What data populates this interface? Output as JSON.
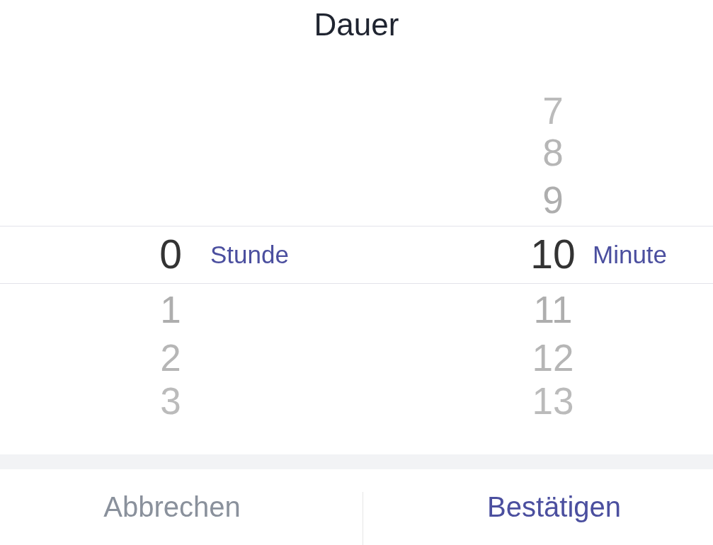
{
  "title": "Dauer",
  "pickers": [
    {
      "items": [
        {
          "value": "0",
          "selected": true
        },
        {
          "value": "1",
          "selected": false
        },
        {
          "value": "2",
          "selected": false
        },
        {
          "value": "3",
          "selected": false
        }
      ],
      "unit": "Stunde"
    },
    {
      "items": [
        {
          "value": "7",
          "selected": false
        },
        {
          "value": "8",
          "selected": false
        },
        {
          "value": "9",
          "selected": false
        },
        {
          "value": "10",
          "selected": true
        },
        {
          "value": "11",
          "selected": false
        },
        {
          "value": "12",
          "selected": false
        },
        {
          "value": "13",
          "selected": false
        }
      ],
      "unit": "Minute"
    }
  ],
  "buttons": [
    {
      "label": "Abbrechen",
      "kind": "cancel"
    },
    {
      "label": "Bestätigen",
      "kind": "confirm"
    }
  ]
}
